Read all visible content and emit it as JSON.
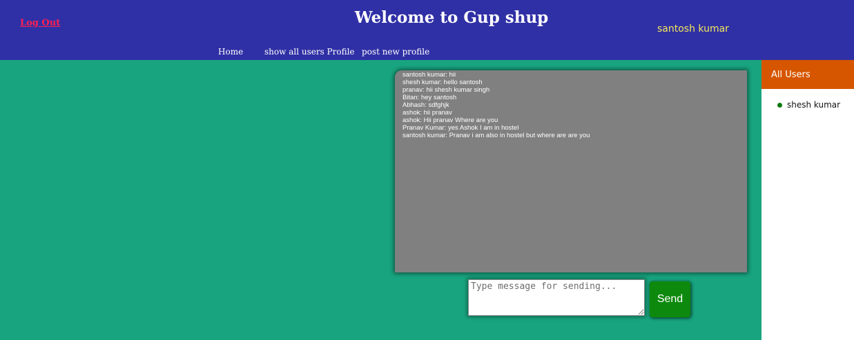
{
  "header": {
    "logout_label": "Log Out",
    "title": "Welcome to Gup shup",
    "current_user": "santosh kumar",
    "nav": [
      {
        "label": "Home"
      },
      {
        "label": "show all users Profile"
      },
      {
        "label": "post new profile"
      }
    ]
  },
  "chat": {
    "messages": [
      "santosh kumar: hii",
      "shesh kumar: hello santosh",
      "pranav: hii shesh kumar singh",
      "Bitan: hey santosh",
      "Abhash: sdfghjk",
      "ashok: hii pranav",
      "ashok: Hii pranav Where are you",
      "Pranav Kumar: yes Ashok I am in hostel",
      "santosh kumar: Pranav i am also in hostel but where are are you"
    ],
    "input_placeholder": "Type message for sending...",
    "input_value": "",
    "send_label": "Send"
  },
  "sidebar": {
    "title": "All Users",
    "users": [
      {
        "name": "shesh kumar",
        "status": "online",
        "status_color": "#0a7a0a"
      }
    ]
  },
  "colors": {
    "header_bg": "#3030a6",
    "main_bg": "#18a47f",
    "chat_bg": "#808080",
    "sidebar_header_bg": "#d65600",
    "send_button_bg": "#0d8a0d",
    "logout_color": "#ff1f4f",
    "username_color": "#f2e65a"
  }
}
